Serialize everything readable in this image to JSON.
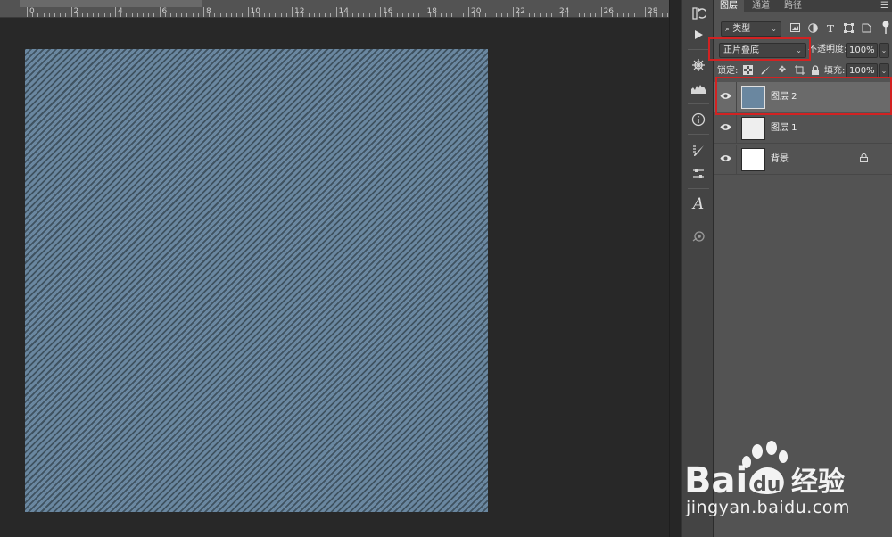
{
  "ruler": {
    "labels": [
      "0",
      "2",
      "4",
      "6",
      "8",
      "10",
      "12",
      "14",
      "16",
      "18",
      "20",
      "22",
      "24",
      "26",
      "28"
    ]
  },
  "layers_panel": {
    "tabs": [
      {
        "label": "图层",
        "active": true
      },
      {
        "label": "通道",
        "active": false
      },
      {
        "label": "路径",
        "active": false
      }
    ],
    "menu_icon": "hamburger-menu-icon",
    "filter": {
      "kind_label": "类型",
      "search_icon": "search-icon",
      "icons": [
        "image-filter-icon",
        "adjustment-filter-icon",
        "type-filter-icon",
        "shape-filter-icon",
        "smart-object-filter-icon"
      ]
    },
    "blend_mode": "正片叠底",
    "opacity_label": "不透明度:",
    "opacity_value": "100%",
    "lock_label": "锁定:",
    "fill_label": "填充:",
    "fill_value": "100%",
    "lock_icons": [
      "lock-transparent-icon",
      "lock-image-icon",
      "lock-position-icon",
      "lock-artboard-icon",
      "lock-all-icon"
    ],
    "layers": [
      {
        "name": "图层 2",
        "selected": true,
        "thumb_color": "#6a87a0",
        "locked": false
      },
      {
        "name": "图层 1",
        "selected": false,
        "thumb_color": "#eeeeee",
        "locked": false
      },
      {
        "name": "背景",
        "selected": false,
        "thumb_color": "#ffffff",
        "locked": true
      }
    ]
  },
  "toolstrip": {
    "icons": [
      "history-icon",
      "play-actions-icon",
      "navigator-icon",
      "histogram-icon",
      "info-icon",
      "brush-presets-icon",
      "adjust-icon",
      "character-icon",
      "3d-icon"
    ]
  },
  "document": {
    "fill_color": "#6a87a0",
    "stripe_color": "#3f5260"
  },
  "watermark": {
    "brand": "Bai",
    "brand2": "du",
    "product": "经验",
    "url": "jingyan.baidu.com"
  },
  "colors": {
    "highlight": "#d22222",
    "panel_bg": "#535353",
    "canvas_bg": "#282828"
  }
}
